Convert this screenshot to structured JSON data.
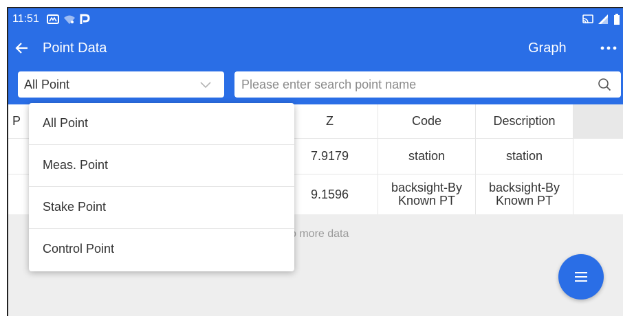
{
  "status_bar": {
    "time": "11:51",
    "icons": [
      "app-notification-icon",
      "wifi-icon",
      "parking-icon",
      "cast-icon",
      "signal-icon",
      "battery-icon"
    ]
  },
  "app_bar": {
    "title": "Point Data",
    "graph_label": "Graph"
  },
  "filter": {
    "selected": "All Point",
    "options": [
      "All Point",
      "Meas. Point",
      "Stake Point",
      "Control Point"
    ]
  },
  "search": {
    "value": "",
    "placeholder": "Please enter search point name"
  },
  "table": {
    "columns": [
      "P",
      "Z",
      "Code",
      "Description"
    ],
    "rows": [
      {
        "z": "7.9179",
        "code": "station",
        "description": "station"
      },
      {
        "z": "9.1596",
        "code": "backsight-By Known PT",
        "description": "backsight-By Known PT"
      }
    ]
  },
  "footer_text": "o more data",
  "colors": {
    "primary": "#2a6ee6",
    "background": "#eeeeee",
    "text": "#333333",
    "muted": "#9a9a9a"
  }
}
